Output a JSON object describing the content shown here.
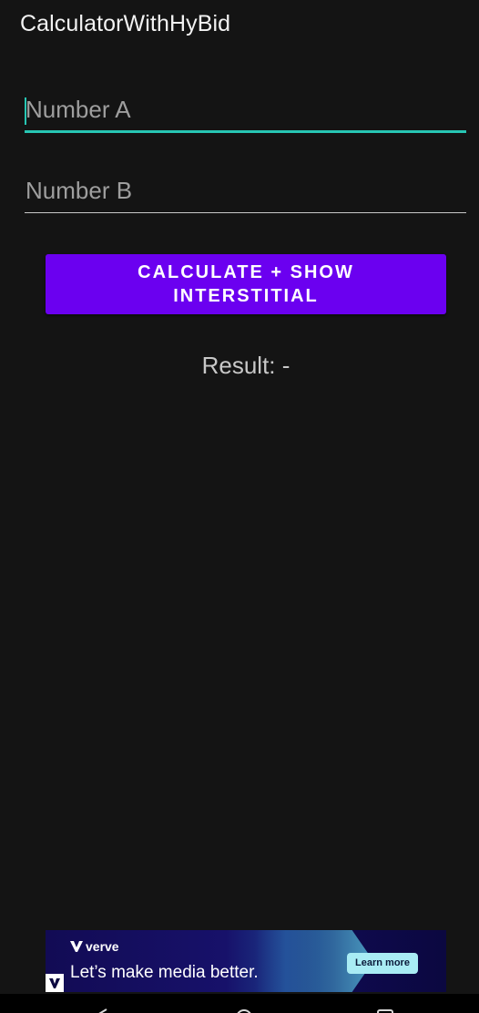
{
  "app": {
    "title": "CalculatorWithHyBid"
  },
  "form": {
    "number_a": {
      "placeholder": "Number A",
      "value": ""
    },
    "number_b": {
      "placeholder": "Number B",
      "value": ""
    },
    "calculate_button_label": "CALCULATE + SHOW INTERSTITIAL",
    "result_text": "Result: -"
  },
  "ad": {
    "brand": "verve",
    "headline": "Let’s make media better.",
    "cta_label": "Learn more",
    "badge_icon": "verve-badge-icon"
  },
  "nav": {
    "icons": [
      "back-icon",
      "home-icon",
      "recents-icon"
    ]
  },
  "colors": {
    "background": "#141414",
    "accent": "#27c6b4",
    "button": "#6b00f0"
  }
}
